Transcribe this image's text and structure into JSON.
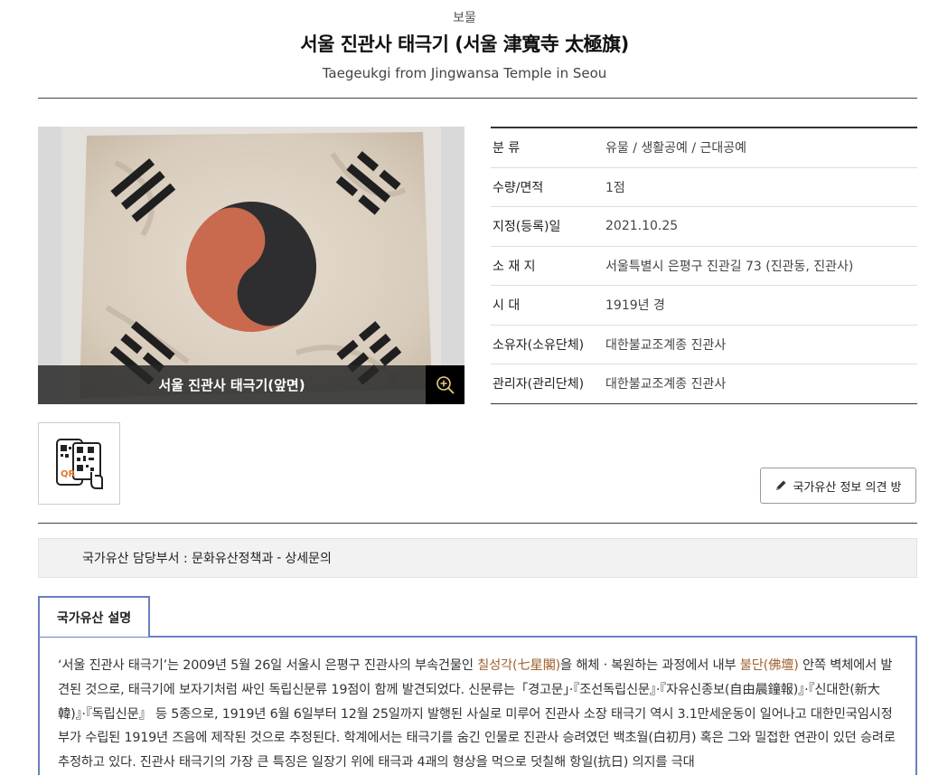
{
  "header": {
    "category": "보물",
    "title": "서울 진관사 태극기 (서울 津寬寺 太極旗)",
    "subtitle": "Taegeukgi from Jingwansa Temple in Seou"
  },
  "image": {
    "caption": "서울 진관사 태극기(앞면)",
    "zoom_icon": "zoom-in-icon"
  },
  "info": [
    {
      "label": "분 류",
      "value": "유물 / 생활공예 / 근대공예"
    },
    {
      "label": "수량/면적",
      "value": "1점"
    },
    {
      "label": "지정(등록)일",
      "value": "2021.10.25"
    },
    {
      "label": "소 재 지",
      "value": "서울특별시 은평구 진관길 73 (진관동, 진관사)"
    },
    {
      "label": "시 대",
      "value": "1919년 경"
    },
    {
      "label": "소유자(소유단체)",
      "value": "대한불교조계종 진관사"
    },
    {
      "label": "관리자(관리단체)",
      "value": "대한불교조계종 진관사"
    }
  ],
  "qr": {
    "label": "QR"
  },
  "opinion_button": {
    "label": "국가유산 정보 의견 방"
  },
  "dept": {
    "text": "국가유산 담당부서 : 문화유산정책과",
    "link": "상세문의"
  },
  "description": {
    "tab_label": "국가유산 설명",
    "p1": "‘서울 진관사 태극기’는 2009년 5월 26일 서울시 은평구 진관사의 부속건물인 ",
    "hl1": "칠성각(七星閣)",
    "p2": "을 해체ㆍ복원하는 과정에서 내부 ",
    "hl2": "불단(佛壇)",
    "p3": " 안쪽 벽체에서 발견된 것으로, 태극기에 보자기처럼 싸인 독립신문류 19점이 함께 발견되었다. 신문류는「경고문」·『조선독립신문』·『자유신종보(自由晨鐘報)』·『신대한(新大韓)』·『독립신문』 등 5종으로, 1919년 6월 6일부터 12월 25일까지 발행된 사실로 미루어 진관사 소장 태극기 역시 3.1만세운동이 일어나고 대한민국임시정부가 수립된 1919년 즈음에 제작된 것으로 추정된다. 학계에서는 태극기를 숨긴 인물로 진관사 승려였던 백초월(白初月) 혹은 그와 밀접한 연관이 있던 승려로 추정하고 있다. 진관사 태극기의 가장 큰 특징은 일장기 위에 태극과 4괘의 형상을 먹으로 덧칠해 항일(抗日) 의지를 극대"
  },
  "colors": {
    "accent_border": "#6a7fc1",
    "highlight_text": "#a0622e",
    "flag_red": "#c96a4e",
    "flag_dark": "#2e2e30"
  }
}
